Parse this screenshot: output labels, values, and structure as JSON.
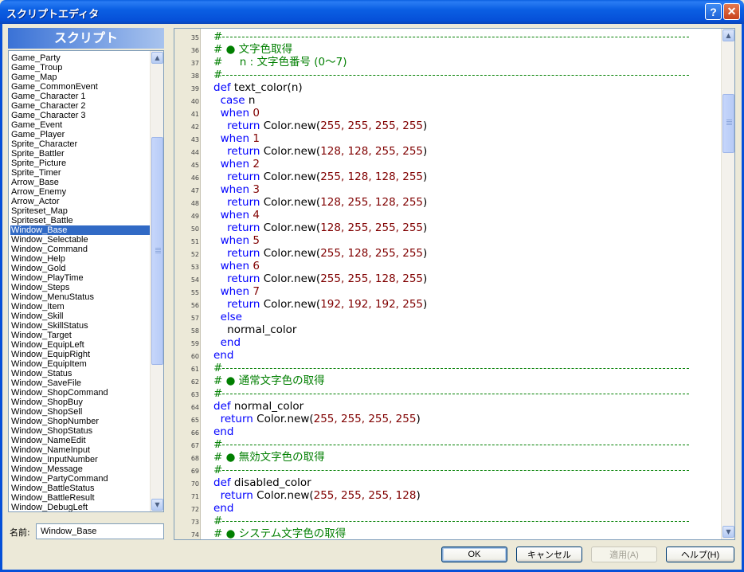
{
  "window": {
    "title": "スクリプトエディタ",
    "help_glyph": "?",
    "close_glyph": "✕"
  },
  "script_list": {
    "header": "スクリプト",
    "items": [
      "Game_Party",
      "Game_Troup",
      "Game_Map",
      "Game_CommonEvent",
      "Game_Character 1",
      "Game_Character 2",
      "Game_Character 3",
      "Game_Event",
      "Game_Player",
      "Sprite_Character",
      "Sprite_Battler",
      "Sprite_Picture",
      "Sprite_Timer",
      "Arrow_Base",
      "Arrow_Enemy",
      "Arrow_Actor",
      "Spriteset_Map",
      "Spriteset_Battle",
      "Window_Base",
      "Window_Selectable",
      "Window_Command",
      "Window_Help",
      "Window_Gold",
      "Window_PlayTime",
      "Window_Steps",
      "Window_MenuStatus",
      "Window_Item",
      "Window_Skill",
      "Window_SkillStatus",
      "Window_Target",
      "Window_EquipLeft",
      "Window_EquipRight",
      "Window_EquipItem",
      "Window_Status",
      "Window_SaveFile",
      "Window_ShopCommand",
      "Window_ShopBuy",
      "Window_ShopSell",
      "Window_ShopNumber",
      "Window_ShopStatus",
      "Window_NameEdit",
      "Window_NameInput",
      "Window_InputNumber",
      "Window_Message",
      "Window_PartyCommand",
      "Window_BattleStatus",
      "Window_BattleResult",
      "Window_DebugLeft"
    ],
    "selected_index": 18
  },
  "name_field": {
    "label": "名前:",
    "value": "Window_Base"
  },
  "editor": {
    "lines": [
      {
        "n": "35",
        "type": "dash"
      },
      {
        "n": "36",
        "parts": [
          {
            "c": "comment",
            "t": "# ● 文字色取得"
          }
        ]
      },
      {
        "n": "37",
        "parts": [
          {
            "c": "comment",
            "t": "#     n : 文字色番号 (0〜7)"
          }
        ]
      },
      {
        "n": "38",
        "type": "dash"
      },
      {
        "n": "39",
        "parts": [
          {
            "c": "kw",
            "t": "def "
          },
          {
            "c": "plain",
            "t": "text_color(n)"
          }
        ]
      },
      {
        "n": "40",
        "parts": [
          {
            "c": "kw",
            "t": "  case "
          },
          {
            "c": "plain",
            "t": "n"
          }
        ]
      },
      {
        "n": "41",
        "parts": [
          {
            "c": "kw",
            "t": "  when "
          },
          {
            "c": "num",
            "t": "0"
          }
        ]
      },
      {
        "n": "42",
        "parts": [
          {
            "c": "kw",
            "t": "    return "
          },
          {
            "c": "plain",
            "t": "Color.new("
          },
          {
            "c": "num",
            "t": "255, 255, 255, 255"
          },
          {
            "c": "plain",
            "t": ")"
          }
        ]
      },
      {
        "n": "43",
        "parts": [
          {
            "c": "kw",
            "t": "  when "
          },
          {
            "c": "num",
            "t": "1"
          }
        ]
      },
      {
        "n": "44",
        "parts": [
          {
            "c": "kw",
            "t": "    return "
          },
          {
            "c": "plain",
            "t": "Color.new("
          },
          {
            "c": "num",
            "t": "128, 128, 255, 255"
          },
          {
            "c": "plain",
            "t": ")"
          }
        ]
      },
      {
        "n": "45",
        "parts": [
          {
            "c": "kw",
            "t": "  when "
          },
          {
            "c": "num",
            "t": "2"
          }
        ]
      },
      {
        "n": "46",
        "parts": [
          {
            "c": "kw",
            "t": "    return "
          },
          {
            "c": "plain",
            "t": "Color.new("
          },
          {
            "c": "num",
            "t": "255, 128, 128, 255"
          },
          {
            "c": "plain",
            "t": ")"
          }
        ]
      },
      {
        "n": "47",
        "parts": [
          {
            "c": "kw",
            "t": "  when "
          },
          {
            "c": "num",
            "t": "3"
          }
        ]
      },
      {
        "n": "48",
        "parts": [
          {
            "c": "kw",
            "t": "    return "
          },
          {
            "c": "plain",
            "t": "Color.new("
          },
          {
            "c": "num",
            "t": "128, 255, 128, 255"
          },
          {
            "c": "plain",
            "t": ")"
          }
        ]
      },
      {
        "n": "49",
        "parts": [
          {
            "c": "kw",
            "t": "  when "
          },
          {
            "c": "num",
            "t": "4"
          }
        ]
      },
      {
        "n": "50",
        "parts": [
          {
            "c": "kw",
            "t": "    return "
          },
          {
            "c": "plain",
            "t": "Color.new("
          },
          {
            "c": "num",
            "t": "128, 255, 255, 255"
          },
          {
            "c": "plain",
            "t": ")"
          }
        ]
      },
      {
        "n": "51",
        "parts": [
          {
            "c": "kw",
            "t": "  when "
          },
          {
            "c": "num",
            "t": "5"
          }
        ]
      },
      {
        "n": "52",
        "parts": [
          {
            "c": "kw",
            "t": "    return "
          },
          {
            "c": "plain",
            "t": "Color.new("
          },
          {
            "c": "num",
            "t": "255, 128, 255, 255"
          },
          {
            "c": "plain",
            "t": ")"
          }
        ]
      },
      {
        "n": "53",
        "parts": [
          {
            "c": "kw",
            "t": "  when "
          },
          {
            "c": "num",
            "t": "6"
          }
        ]
      },
      {
        "n": "54",
        "parts": [
          {
            "c": "kw",
            "t": "    return "
          },
          {
            "c": "plain",
            "t": "Color.new("
          },
          {
            "c": "num",
            "t": "255, 255, 128, 255"
          },
          {
            "c": "plain",
            "t": ")"
          }
        ]
      },
      {
        "n": "55",
        "parts": [
          {
            "c": "kw",
            "t": "  when "
          },
          {
            "c": "num",
            "t": "7"
          }
        ]
      },
      {
        "n": "56",
        "parts": [
          {
            "c": "kw",
            "t": "    return "
          },
          {
            "c": "plain",
            "t": "Color.new("
          },
          {
            "c": "num",
            "t": "192, 192, 192, 255"
          },
          {
            "c": "plain",
            "t": ")"
          }
        ]
      },
      {
        "n": "57",
        "parts": [
          {
            "c": "kw",
            "t": "  else"
          }
        ]
      },
      {
        "n": "58",
        "parts": [
          {
            "c": "plain",
            "t": "    normal_color"
          }
        ]
      },
      {
        "n": "59",
        "parts": [
          {
            "c": "kw",
            "t": "  end"
          }
        ]
      },
      {
        "n": "60",
        "parts": [
          {
            "c": "kw",
            "t": "end"
          }
        ]
      },
      {
        "n": "61",
        "type": "dash"
      },
      {
        "n": "62",
        "parts": [
          {
            "c": "comment",
            "t": "# ● 通常文字色の取得"
          }
        ]
      },
      {
        "n": "63",
        "type": "dash"
      },
      {
        "n": "64",
        "parts": [
          {
            "c": "kw",
            "t": "def "
          },
          {
            "c": "plain",
            "t": "normal_color"
          }
        ]
      },
      {
        "n": "65",
        "parts": [
          {
            "c": "kw",
            "t": "  return "
          },
          {
            "c": "plain",
            "t": "Color.new("
          },
          {
            "c": "num",
            "t": "255, 255, 255, 255"
          },
          {
            "c": "plain",
            "t": ")"
          }
        ]
      },
      {
        "n": "66",
        "parts": [
          {
            "c": "kw",
            "t": "end"
          }
        ]
      },
      {
        "n": "67",
        "type": "dash"
      },
      {
        "n": "68",
        "parts": [
          {
            "c": "comment",
            "t": "# ● 無効文字色の取得"
          }
        ]
      },
      {
        "n": "69",
        "type": "dash"
      },
      {
        "n": "70",
        "parts": [
          {
            "c": "kw",
            "t": "def "
          },
          {
            "c": "plain",
            "t": "disabled_color"
          }
        ]
      },
      {
        "n": "71",
        "parts": [
          {
            "c": "kw",
            "t": "  return "
          },
          {
            "c": "plain",
            "t": "Color.new("
          },
          {
            "c": "num",
            "t": "255, 255, 255, 128"
          },
          {
            "c": "plain",
            "t": ")"
          }
        ]
      },
      {
        "n": "72",
        "parts": [
          {
            "c": "kw",
            "t": "end"
          }
        ]
      },
      {
        "n": "73",
        "type": "dash"
      },
      {
        "n": "74",
        "parts": [
          {
            "c": "comment",
            "t": "# ● システム文字色の取得"
          }
        ]
      }
    ]
  },
  "buttons": {
    "ok": "OK",
    "cancel": "キャンセル",
    "apply": "適用(A)",
    "help": "ヘルプ(H)"
  },
  "icons": {
    "up_arrow": "▲",
    "down_arrow": "▼"
  }
}
